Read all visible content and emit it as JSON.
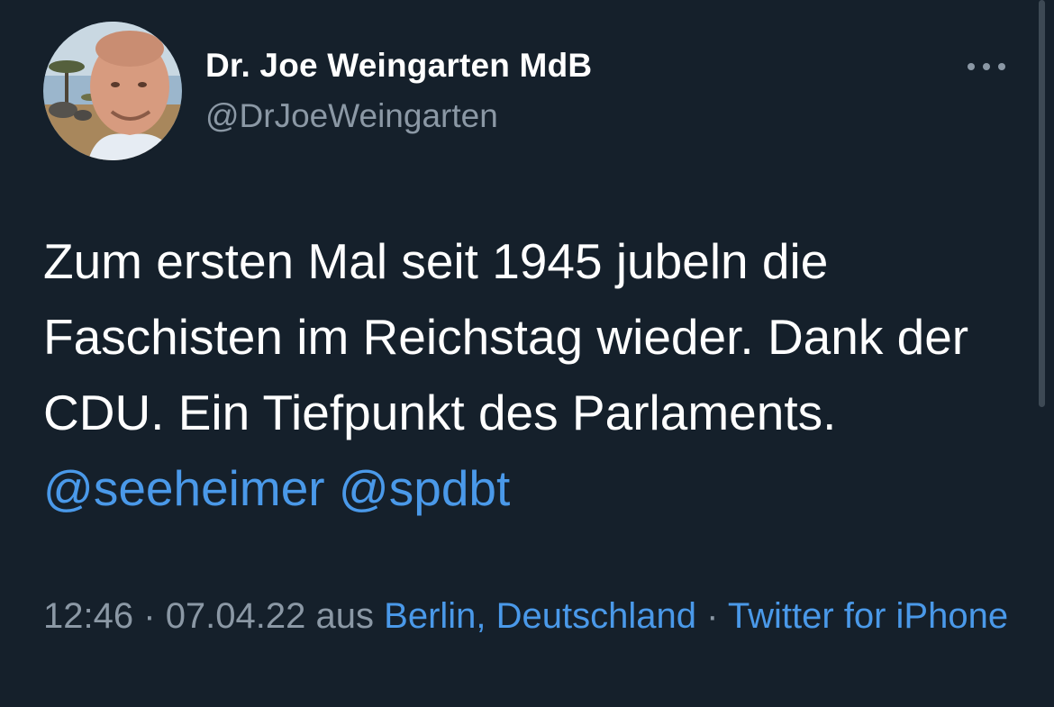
{
  "user": {
    "display_name": "Dr. Joe Weingarten MdB",
    "handle": "@DrJoeWeingarten",
    "avatar_icon": "profile-photo"
  },
  "more_icon": "ellipsis-icon",
  "tweet": {
    "text": "Zum ersten Mal seit 1945 jubeln die Faschisten im Reichstag wieder. Dank der CDU. Ein Tiefpunkt des Parlaments.",
    "mentions": [
      "@seeheimer",
      "@spdbt"
    ]
  },
  "meta": {
    "time": "12:46",
    "separator": "·",
    "date": "07.04.22",
    "from_label": "aus",
    "location": "Berlin, Deutschland",
    "source": "Twitter for iPhone"
  },
  "colors": {
    "background": "#15202b",
    "text_primary": "#ffffff",
    "text_secondary": "#8b98a5",
    "accent": "#4a99e9"
  }
}
